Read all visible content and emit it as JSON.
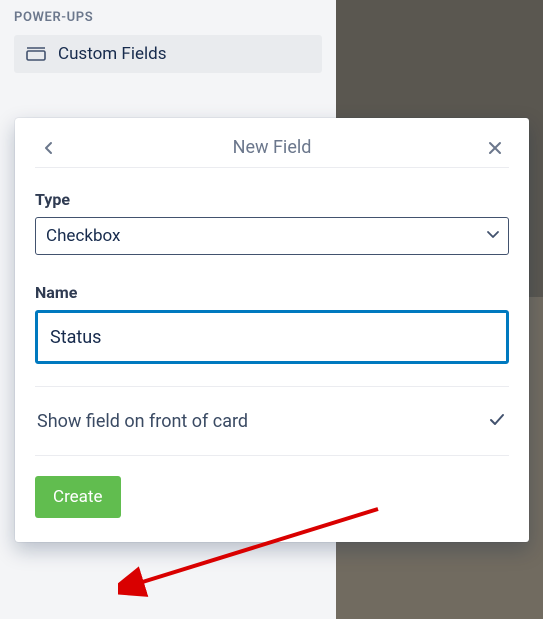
{
  "sidebar": {
    "section_title": "POWER-UPS",
    "item_label": "Custom Fields"
  },
  "popup": {
    "title": "New Field",
    "type_label": "Type",
    "type_value": "Checkbox",
    "name_label": "Name",
    "name_value": "Status",
    "toggle_label": "Show field on front of card",
    "create_label": "Create"
  }
}
